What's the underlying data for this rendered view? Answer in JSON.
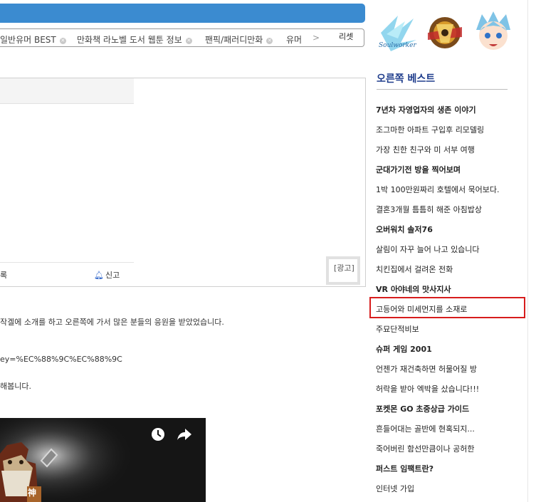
{
  "tagbar": {
    "tags": [
      "일반유머 BEST",
      "만화책 라노벨 도서 웹툰 정보",
      "팬픽/패러디만화",
      "유머"
    ],
    "next_arrow": ">",
    "reset_label": "리셋"
  },
  "post": {
    "action_left": "록",
    "report_label": "신고",
    "ad_label": "[광고]",
    "lines": [
      "작겔에 소개를 하고 오른쪽에 가서 많은 분들의 응원을 받았었습니다.",
      "ey=%EC%88%9C%EC%88%9C",
      "해봅니다."
    ]
  },
  "sidebar": {
    "title": "오른쪽 베스트",
    "items": [
      {
        "label": "7년차 자영업자의 생존 이야기",
        "bold": true
      },
      {
        "label": "조그마한 아파트 구입후 리모델링",
        "bold": false
      },
      {
        "label": "가장 친한 친구와 미 서부 여행",
        "bold": false
      },
      {
        "label": "군대가기전 방을 찍어보며",
        "bold": true
      },
      {
        "label": "1박 100만원짜리 호텔에서 묵어보다.",
        "bold": false
      },
      {
        "label": "결혼3개월 틈틈히 해준 아침밥상",
        "bold": false
      },
      {
        "label": "오버워치 솔저76",
        "bold": true
      },
      {
        "label": "살림이 자꾸 늘어 나고 있습니다",
        "bold": false
      },
      {
        "label": "치킨집에서 걸려온 전화",
        "bold": false
      },
      {
        "label": "VR 아야네의 맛사지사",
        "bold": true
      },
      {
        "label": "고등어와 미세먼지를 소재로",
        "bold": false
      },
      {
        "label": "주묘단적비보",
        "bold": false
      },
      {
        "label": "슈퍼 게임 2001",
        "bold": true
      },
      {
        "label": "언젠가 재건축하면 허물어질 방",
        "bold": false
      },
      {
        "label": "허락을 받아 엑박을 샀습니다!!!",
        "bold": false
      },
      {
        "label": "포켓몬 GO 초중상급 가이드",
        "bold": true
      },
      {
        "label": "흔들어대는 골반에 현혹되지...",
        "bold": false
      },
      {
        "label": "죽어버린 함선만큼이나 공허한",
        "bold": false
      },
      {
        "label": "퍼스트 임팩트란?",
        "bold": true
      },
      {
        "label": "인터넷 가입",
        "bold": false
      }
    ]
  },
  "video": {
    "badge_glyph": "神",
    "icons": [
      "clock-icon",
      "share-icon"
    ]
  },
  "colors": {
    "topbar": "#3b8bd0",
    "sidebar_title": "#1f3d8c",
    "highlight": "#d71c1c"
  }
}
